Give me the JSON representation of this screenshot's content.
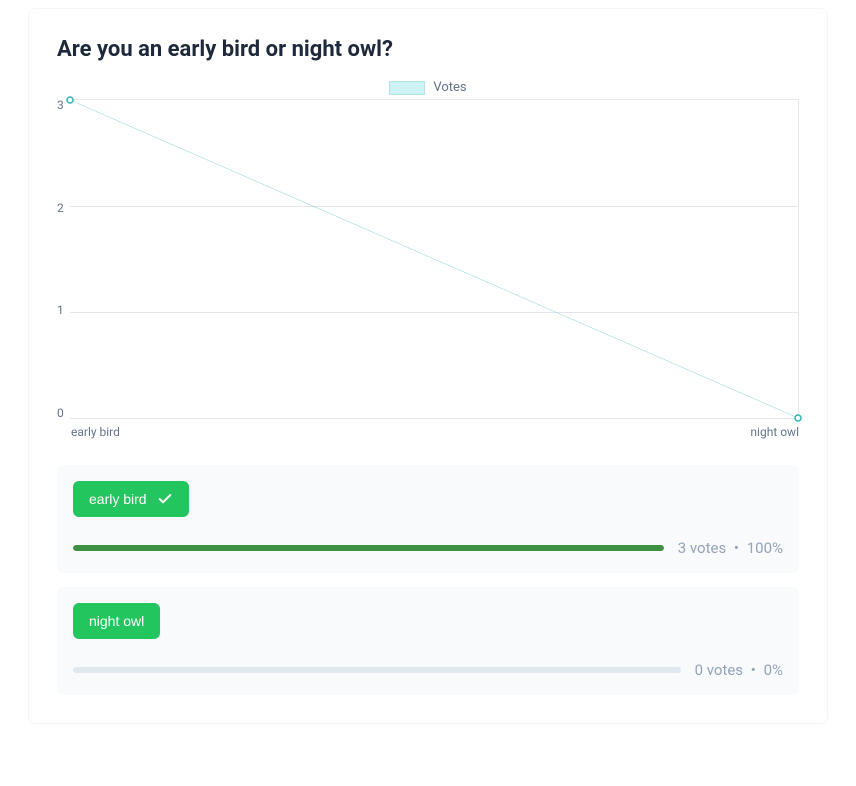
{
  "title": "Are you an early bird or night owl?",
  "legend_label": "Votes",
  "chart_data": {
    "type": "line",
    "categories": [
      "early bird",
      "night owl"
    ],
    "values": [
      3,
      0
    ],
    "title": "",
    "xlabel": "",
    "ylabel": "",
    "ylim": [
      0,
      3
    ],
    "yticks": [
      0,
      1,
      2,
      3
    ],
    "legend": "Votes",
    "line_color": "#2bb3b8",
    "point_fill": "#ffffff"
  },
  "options": [
    {
      "label": "early bird",
      "selected": true,
      "votes_text": "3 votes",
      "percent_text": "100%",
      "bar_percent": 100
    },
    {
      "label": "night owl",
      "selected": false,
      "votes_text": "0 votes",
      "percent_text": "0%",
      "bar_percent": 0
    }
  ],
  "sep": "•"
}
